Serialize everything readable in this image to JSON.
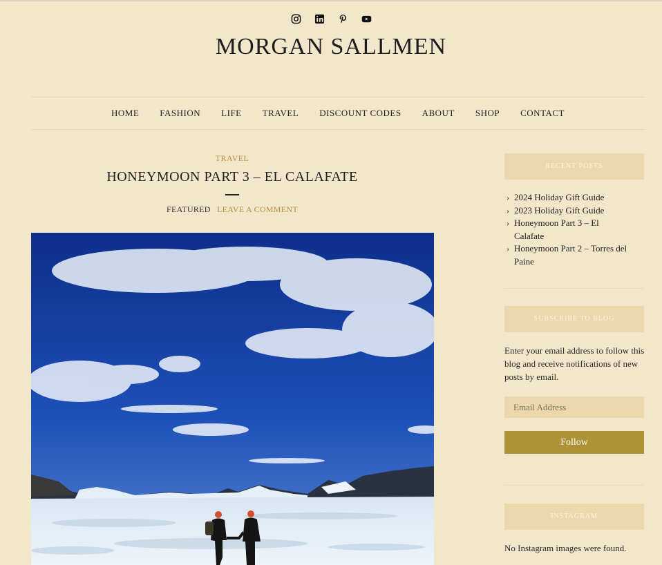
{
  "site": {
    "title": "MORGAN SALLMEN"
  },
  "social": [
    "instagram-icon",
    "linkedin-icon",
    "pinterest-icon",
    "youtube-icon"
  ],
  "nav": {
    "items": [
      "HOME",
      "FASHION",
      "LIFE",
      "TRAVEL",
      "DISCOUNT CODES",
      "ABOUT",
      "SHOP",
      "CONTACT"
    ]
  },
  "post": {
    "category": "TRAVEL",
    "title": "HONEYMOON PART 3 – EL CALAFATE",
    "featured": "FEATURED",
    "comment_link": "LEAVE A COMMENT"
  },
  "sidebar": {
    "recent_heading": "RECENT POSTS",
    "recent_posts": [
      "2024 Holiday Gift Guide",
      "2023 Holiday Gift Guide",
      "Honeymoon Part 3 – El Calafate",
      "Honeymoon Part 2 – Torres del Paine"
    ],
    "subscribe_heading": "SUBSCRIBE TO BLOG",
    "subscribe_text": "Enter your email address to follow this blog and receive notifications of new posts by email.",
    "email_placeholder": "Email Address",
    "follow_label": "Follow",
    "instagram_heading": "INSTAGRAM",
    "instagram_empty": "No Instagram images were found."
  },
  "colors": {
    "background": "#f2e6cb",
    "accent_gold": "#b8913f",
    "widget_bg": "#ebd9ad",
    "button": "#ae9238"
  }
}
